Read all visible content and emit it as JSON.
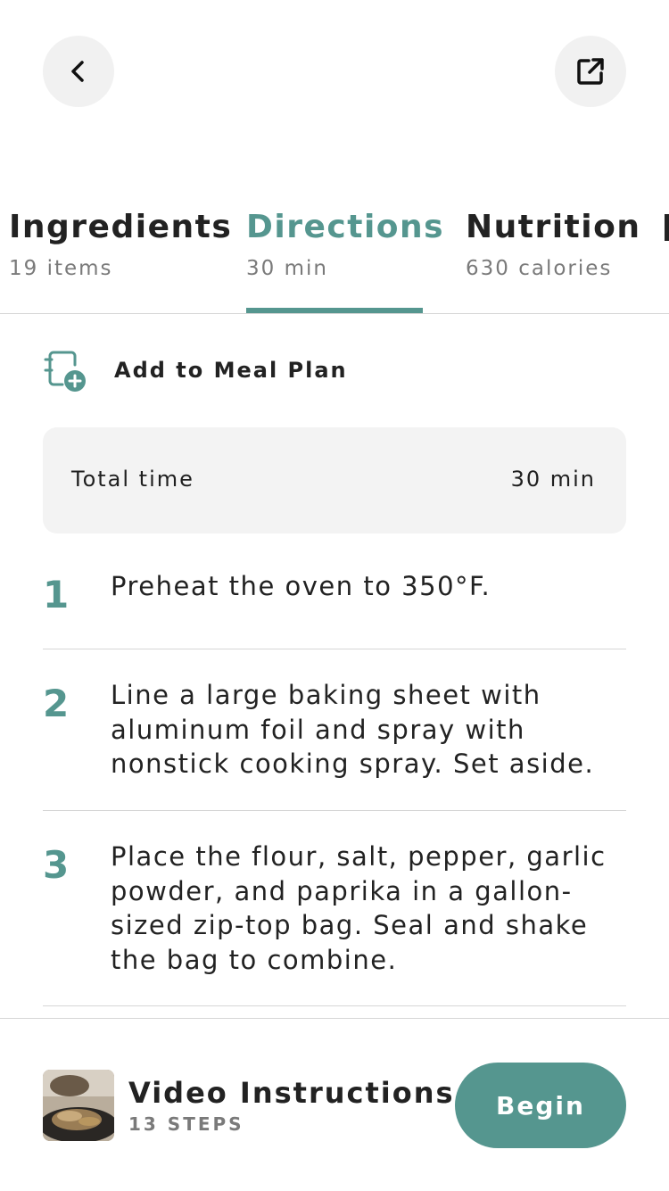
{
  "header": {
    "back_icon": "chevron-left-icon",
    "share_icon": "external-link-icon"
  },
  "tabs": [
    {
      "title": "Ingredients",
      "subtitle": "19 items",
      "active": false
    },
    {
      "title": "Directions",
      "subtitle": "30 min",
      "active": true
    },
    {
      "title": "Nutrition",
      "subtitle": "630 calories",
      "active": false
    }
  ],
  "meal_plan": {
    "label": "Add to Meal Plan",
    "icon": "calendar-add-icon"
  },
  "total_time": {
    "label": "Total time",
    "value": "30 min"
  },
  "steps": [
    {
      "number": "1",
      "text": "Preheat the oven to 350°F."
    },
    {
      "number": "2",
      "text": "Line a large baking sheet with aluminum foil and spray with nonstick cooking spray. Set aside."
    },
    {
      "number": "3",
      "text": "Place the flour, salt, pepper, garlic powder, and paprika in a gallon-sized zip-top bag. Seal and shake the bag to combine."
    }
  ],
  "video": {
    "title": "Video Instructions",
    "subtitle": "13 STEPS",
    "button_label": "Begin"
  },
  "colors": {
    "accent": "#55968f",
    "muted_text": "#7a7a7a",
    "panel_bg": "#f3f3f3",
    "divider": "#d6d6d6"
  }
}
